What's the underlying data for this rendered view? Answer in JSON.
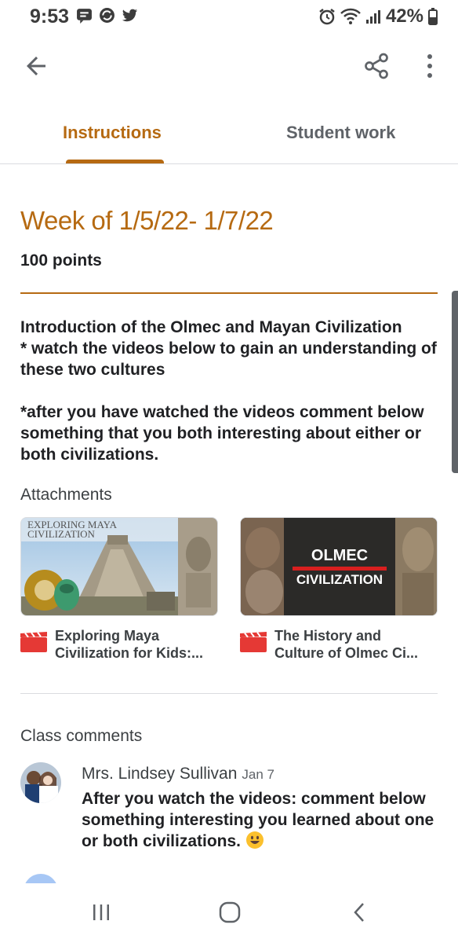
{
  "status_bar": {
    "time": "9:53",
    "battery_pct": "42%",
    "left_icons": [
      "message-icon",
      "sync-icon",
      "twitter-icon"
    ],
    "right_icons": [
      "alarm-icon",
      "wifi-icon",
      "signal-icon",
      "battery-icon"
    ]
  },
  "tabs": [
    {
      "label": "Instructions",
      "active": true
    },
    {
      "label": "Student work",
      "active": false
    }
  ],
  "assignment": {
    "title": "Week of 1/5/22- 1/7/22",
    "points": "100 points",
    "description": "Introduction of the Olmec and Mayan Civilization\n* watch the videos below to gain an understanding of these two cultures\n\n*after you have watched the videos comment below something that you both interesting about either or both civilizations."
  },
  "attachments": {
    "header": "Attachments",
    "items": [
      {
        "title": "Exploring Maya Civilization for Kids:...",
        "thumb_text": "EXPLORING MAYA CIVILIZATION",
        "icon": "video-icon"
      },
      {
        "title": "The History and Culture of Olmec Ci...",
        "thumb_text_line1": "OLMEC",
        "thumb_text_line2": "CIVILIZATION",
        "icon": "video-icon"
      }
    ]
  },
  "comments": {
    "header": "Class comments",
    "items": [
      {
        "author": "Mrs. Lindsey Sullivan",
        "date": "Jan 7",
        "text": "After you watch the videos: comment below something interesting you learned about one or both civilizations."
      }
    ]
  },
  "colors": {
    "accent": "#b66a12",
    "video_icon": "#e53935"
  }
}
